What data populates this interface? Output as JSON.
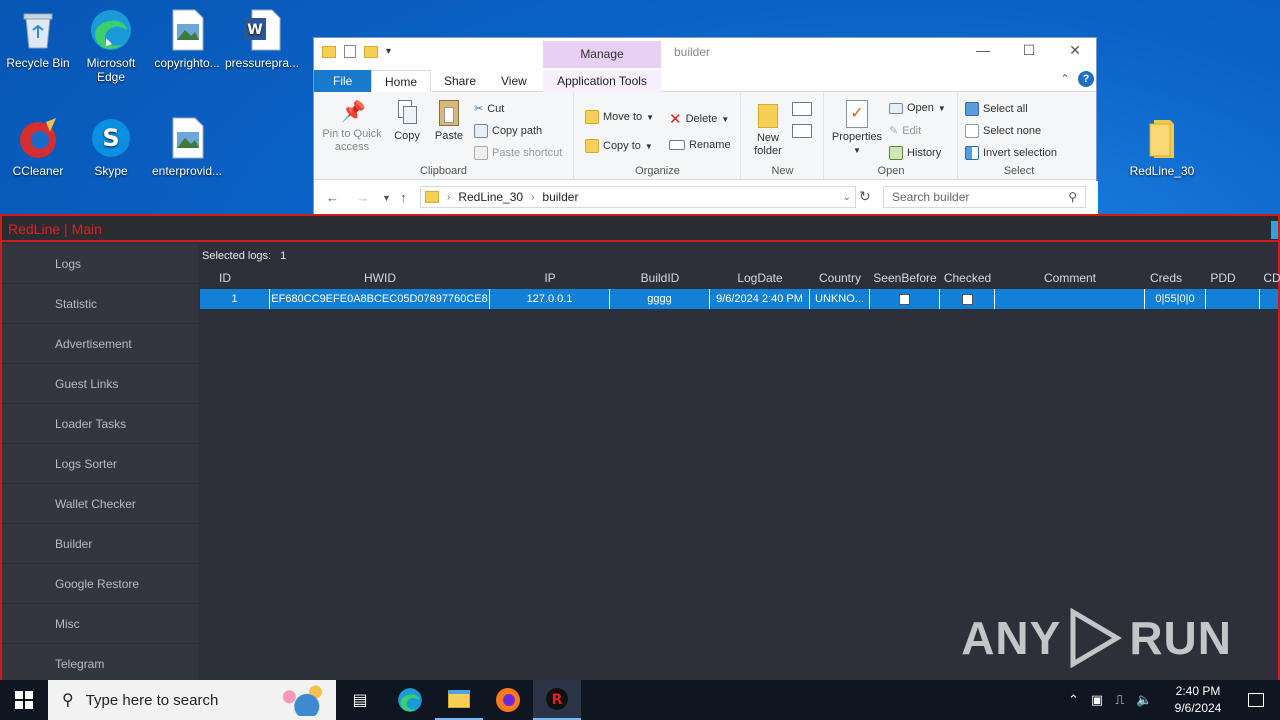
{
  "desktop": {
    "icons": [
      {
        "label": "Recycle Bin"
      },
      {
        "label": "Microsoft Edge"
      },
      {
        "label": "copyrighto..."
      },
      {
        "label": "pressurepra..."
      },
      {
        "label": "CCleaner"
      },
      {
        "label": "Skype"
      },
      {
        "label": "enterprovid..."
      },
      {
        "label": "RedLine_30"
      }
    ]
  },
  "explorer": {
    "title": "builder",
    "manage_label": "Manage",
    "tabs": {
      "file": "File",
      "home": "Home",
      "share": "Share",
      "view": "View",
      "app_tools": "Application Tools"
    },
    "ribbon": {
      "clipboard": {
        "group": "Clipboard",
        "pin": "Pin to Quick access",
        "copy": "Copy",
        "paste": "Paste",
        "cut": "Cut",
        "copy_path": "Copy path",
        "paste_shortcut": "Paste shortcut"
      },
      "organize": {
        "group": "Organize",
        "move_to": "Move to",
        "copy_to": "Copy to",
        "delete": "Delete",
        "rename": "Rename"
      },
      "new": {
        "group": "New",
        "new_folder": "New folder"
      },
      "open": {
        "group": "Open",
        "properties": "Properties",
        "open": "Open",
        "edit": "Edit",
        "history": "History"
      },
      "select": {
        "group": "Select",
        "select_all": "Select all",
        "select_none": "Select none",
        "invert": "Invert selection"
      }
    },
    "address": {
      "crumbs": [
        "RedLine_30",
        "builder"
      ]
    },
    "search": {
      "placeholder": "Search builder"
    }
  },
  "redline": {
    "title": "RedLine | Main",
    "sidebar": [
      "Logs",
      "Statistic",
      "Advertisement",
      "Guest Links",
      "Loader Tasks",
      "Logs Sorter",
      "Wallet Checker",
      "Builder",
      "Google Restore",
      "Misc",
      "Telegram"
    ],
    "selected_logs_label": "Selected logs:",
    "selected_logs_count": "1",
    "columns": [
      "ID",
      "HWID",
      "IP",
      "BuildID",
      "LogDate",
      "Country",
      "SeenBefore",
      "Checked",
      "Comment",
      "Creds",
      "PDD",
      "CD"
    ],
    "rows": [
      {
        "id": "1",
        "hwid": "EF680CC9EFE0A8BCEC05D07897760CE8",
        "ip": "127.0.0.1",
        "build_id": "gggg",
        "log_date": "9/6/2024 2:40 PM",
        "country": "UNKNO...",
        "seen_before": false,
        "checked": false,
        "comment": "",
        "creds": "0|55|0|0",
        "pdd": ""
      }
    ]
  },
  "watermark": {
    "left": "ANY",
    "right": "RUN"
  },
  "taskbar": {
    "search_placeholder": "Type here to search",
    "time": "2:40 PM",
    "date": "9/6/2024"
  },
  "colors": {
    "accent": "#1380d7",
    "redline_red": "#d01c1c",
    "taskbar": "#101522"
  }
}
